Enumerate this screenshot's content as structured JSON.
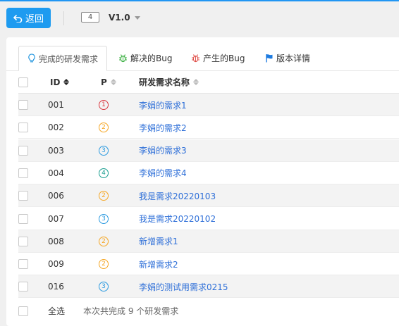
{
  "toolbar": {
    "back_label": "返回",
    "version_badge": "4",
    "version_select": "V1.0"
  },
  "tabs": [
    {
      "label": "完成的研发需求",
      "icon": "lightbulb-icon",
      "active": true
    },
    {
      "label": "解决的Bug",
      "icon": "bug-icon"
    },
    {
      "label": "产生的Bug",
      "icon": "bug-icon"
    },
    {
      "label": "版本详情",
      "icon": "flag-icon"
    }
  ],
  "table": {
    "columns": {
      "id": "ID",
      "priority": "P",
      "name": "研发需求名称"
    },
    "rows": [
      {
        "id": "001",
        "priority": "1",
        "name": "李娟的需求1"
      },
      {
        "id": "002",
        "priority": "2",
        "name": "李娟的需求2"
      },
      {
        "id": "003",
        "priority": "3",
        "name": "李娟的需求3"
      },
      {
        "id": "004",
        "priority": "4",
        "name": "李娟的需求4"
      },
      {
        "id": "006",
        "priority": "2",
        "name": "我是需求20220103"
      },
      {
        "id": "007",
        "priority": "3",
        "name": "我是需求20220102"
      },
      {
        "id": "008",
        "priority": "2",
        "name": "新增需求1"
      },
      {
        "id": "009",
        "priority": "2",
        "name": "新增需求2"
      },
      {
        "id": "016",
        "priority": "3",
        "name": "李娟的测试用需求0215"
      }
    ]
  },
  "footer": {
    "select_all_label": "全选",
    "summary": "本次共完成 9 个研发需求"
  },
  "colors": {
    "accent": "#1e9bf0",
    "link": "#2e6fd8",
    "priority_1": "#d9363e",
    "priority_2": "#f5a623",
    "priority_3": "#2b9ae0",
    "priority_4": "#1a9e8f",
    "bug_resolved": "#3cb043",
    "bug_created": "#e0504a",
    "flag": "#1e7be0"
  }
}
